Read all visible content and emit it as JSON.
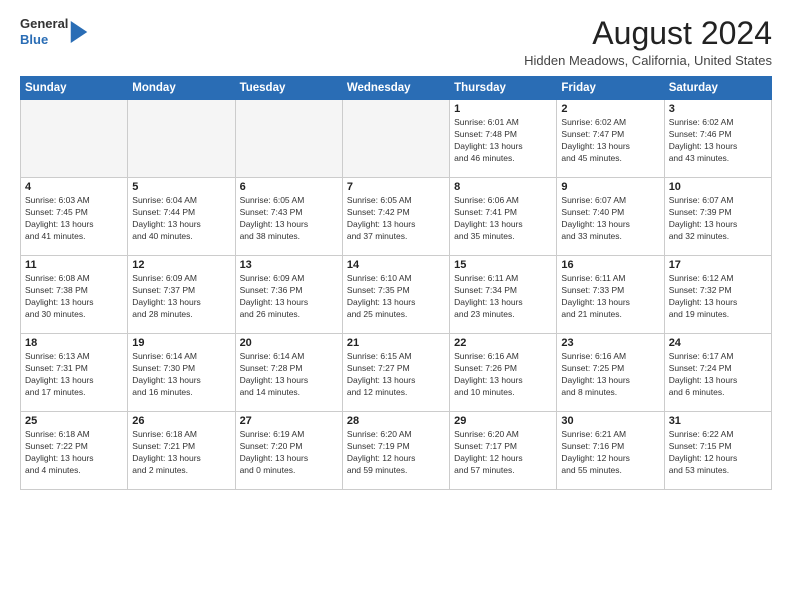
{
  "logo": {
    "general": "General",
    "blue": "Blue"
  },
  "header": {
    "month": "August 2024",
    "location": "Hidden Meadows, California, United States"
  },
  "weekdays": [
    "Sunday",
    "Monday",
    "Tuesday",
    "Wednesday",
    "Thursday",
    "Friday",
    "Saturday"
  ],
  "weeks": [
    [
      {
        "day": "",
        "lines": []
      },
      {
        "day": "",
        "lines": []
      },
      {
        "day": "",
        "lines": []
      },
      {
        "day": "",
        "lines": []
      },
      {
        "day": "1",
        "lines": [
          "Sunrise: 6:01 AM",
          "Sunset: 7:48 PM",
          "Daylight: 13 hours",
          "and 46 minutes."
        ]
      },
      {
        "day": "2",
        "lines": [
          "Sunrise: 6:02 AM",
          "Sunset: 7:47 PM",
          "Daylight: 13 hours",
          "and 45 minutes."
        ]
      },
      {
        "day": "3",
        "lines": [
          "Sunrise: 6:02 AM",
          "Sunset: 7:46 PM",
          "Daylight: 13 hours",
          "and 43 minutes."
        ]
      }
    ],
    [
      {
        "day": "4",
        "lines": [
          "Sunrise: 6:03 AM",
          "Sunset: 7:45 PM",
          "Daylight: 13 hours",
          "and 41 minutes."
        ]
      },
      {
        "day": "5",
        "lines": [
          "Sunrise: 6:04 AM",
          "Sunset: 7:44 PM",
          "Daylight: 13 hours",
          "and 40 minutes."
        ]
      },
      {
        "day": "6",
        "lines": [
          "Sunrise: 6:05 AM",
          "Sunset: 7:43 PM",
          "Daylight: 13 hours",
          "and 38 minutes."
        ]
      },
      {
        "day": "7",
        "lines": [
          "Sunrise: 6:05 AM",
          "Sunset: 7:42 PM",
          "Daylight: 13 hours",
          "and 37 minutes."
        ]
      },
      {
        "day": "8",
        "lines": [
          "Sunrise: 6:06 AM",
          "Sunset: 7:41 PM",
          "Daylight: 13 hours",
          "and 35 minutes."
        ]
      },
      {
        "day": "9",
        "lines": [
          "Sunrise: 6:07 AM",
          "Sunset: 7:40 PM",
          "Daylight: 13 hours",
          "and 33 minutes."
        ]
      },
      {
        "day": "10",
        "lines": [
          "Sunrise: 6:07 AM",
          "Sunset: 7:39 PM",
          "Daylight: 13 hours",
          "and 32 minutes."
        ]
      }
    ],
    [
      {
        "day": "11",
        "lines": [
          "Sunrise: 6:08 AM",
          "Sunset: 7:38 PM",
          "Daylight: 13 hours",
          "and 30 minutes."
        ]
      },
      {
        "day": "12",
        "lines": [
          "Sunrise: 6:09 AM",
          "Sunset: 7:37 PM",
          "Daylight: 13 hours",
          "and 28 minutes."
        ]
      },
      {
        "day": "13",
        "lines": [
          "Sunrise: 6:09 AM",
          "Sunset: 7:36 PM",
          "Daylight: 13 hours",
          "and 26 minutes."
        ]
      },
      {
        "day": "14",
        "lines": [
          "Sunrise: 6:10 AM",
          "Sunset: 7:35 PM",
          "Daylight: 13 hours",
          "and 25 minutes."
        ]
      },
      {
        "day": "15",
        "lines": [
          "Sunrise: 6:11 AM",
          "Sunset: 7:34 PM",
          "Daylight: 13 hours",
          "and 23 minutes."
        ]
      },
      {
        "day": "16",
        "lines": [
          "Sunrise: 6:11 AM",
          "Sunset: 7:33 PM",
          "Daylight: 13 hours",
          "and 21 minutes."
        ]
      },
      {
        "day": "17",
        "lines": [
          "Sunrise: 6:12 AM",
          "Sunset: 7:32 PM",
          "Daylight: 13 hours",
          "and 19 minutes."
        ]
      }
    ],
    [
      {
        "day": "18",
        "lines": [
          "Sunrise: 6:13 AM",
          "Sunset: 7:31 PM",
          "Daylight: 13 hours",
          "and 17 minutes."
        ]
      },
      {
        "day": "19",
        "lines": [
          "Sunrise: 6:14 AM",
          "Sunset: 7:30 PM",
          "Daylight: 13 hours",
          "and 16 minutes."
        ]
      },
      {
        "day": "20",
        "lines": [
          "Sunrise: 6:14 AM",
          "Sunset: 7:28 PM",
          "Daylight: 13 hours",
          "and 14 minutes."
        ]
      },
      {
        "day": "21",
        "lines": [
          "Sunrise: 6:15 AM",
          "Sunset: 7:27 PM",
          "Daylight: 13 hours",
          "and 12 minutes."
        ]
      },
      {
        "day": "22",
        "lines": [
          "Sunrise: 6:16 AM",
          "Sunset: 7:26 PM",
          "Daylight: 13 hours",
          "and 10 minutes."
        ]
      },
      {
        "day": "23",
        "lines": [
          "Sunrise: 6:16 AM",
          "Sunset: 7:25 PM",
          "Daylight: 13 hours",
          "and 8 minutes."
        ]
      },
      {
        "day": "24",
        "lines": [
          "Sunrise: 6:17 AM",
          "Sunset: 7:24 PM",
          "Daylight: 13 hours",
          "and 6 minutes."
        ]
      }
    ],
    [
      {
        "day": "25",
        "lines": [
          "Sunrise: 6:18 AM",
          "Sunset: 7:22 PM",
          "Daylight: 13 hours",
          "and 4 minutes."
        ]
      },
      {
        "day": "26",
        "lines": [
          "Sunrise: 6:18 AM",
          "Sunset: 7:21 PM",
          "Daylight: 13 hours",
          "and 2 minutes."
        ]
      },
      {
        "day": "27",
        "lines": [
          "Sunrise: 6:19 AM",
          "Sunset: 7:20 PM",
          "Daylight: 13 hours",
          "and 0 minutes."
        ]
      },
      {
        "day": "28",
        "lines": [
          "Sunrise: 6:20 AM",
          "Sunset: 7:19 PM",
          "Daylight: 12 hours",
          "and 59 minutes."
        ]
      },
      {
        "day": "29",
        "lines": [
          "Sunrise: 6:20 AM",
          "Sunset: 7:17 PM",
          "Daylight: 12 hours",
          "and 57 minutes."
        ]
      },
      {
        "day": "30",
        "lines": [
          "Sunrise: 6:21 AM",
          "Sunset: 7:16 PM",
          "Daylight: 12 hours",
          "and 55 minutes."
        ]
      },
      {
        "day": "31",
        "lines": [
          "Sunrise: 6:22 AM",
          "Sunset: 7:15 PM",
          "Daylight: 12 hours",
          "and 53 minutes."
        ]
      }
    ]
  ]
}
